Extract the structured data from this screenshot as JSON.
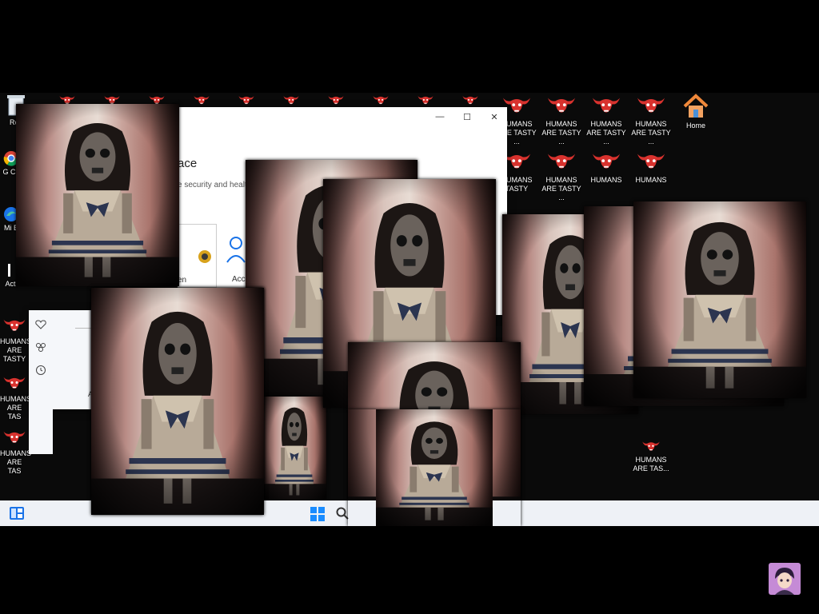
{
  "desktop": {
    "top_icons": [
      {
        "label": "Rec",
        "icon": "recycle-bin-icon"
      },
      {
        "label": "HUMANS ARE TASTY ...",
        "icon": "demon-skull-icon"
      },
      {
        "label": "HUMANS ARE TASTY ...",
        "icon": "demon-skull-icon"
      },
      {
        "label": "HUMANS ARE TASTY ...",
        "icon": "demon-skull-icon"
      },
      {
        "label": "HUMANS ARE TASTY ...",
        "icon": "demon-skull-icon"
      },
      {
        "label": "Home",
        "icon": "home-icon"
      }
    ],
    "second_row_icons": [
      {
        "label": "HUMANS TASTY"
      },
      {
        "label": "HUMANS ARE TASTY ..."
      },
      {
        "label": "HUMANS"
      },
      {
        "label": "HUMANS"
      }
    ],
    "left_icons": [
      {
        "label": "G Ch",
        "icon": "chrome-icon"
      },
      {
        "label": "Mi E",
        "icon": "edge-icon"
      },
      {
        "label": "Acti",
        "icon": "activity-icon"
      },
      {
        "label": "HUMANS ARE TASTY",
        "icon": "demon-skull-icon"
      },
      {
        "label": "HUMANS ARE TAS",
        "icon": "demon-skull-icon"
      },
      {
        "label": "HUMANS ARE TAS",
        "icon": "demon-skull-icon"
      }
    ],
    "bottom_icon": {
      "label": "HUMANS ARE TAS...",
      "icon": "demon-skull-icon"
    }
  },
  "window": {
    "title_fragment": "ace",
    "subtitle_fragment": "e security and healt",
    "tile_left_label": "en",
    "tile_right_label": "Acc",
    "controls": {
      "minimize": "—",
      "maximize": "☐",
      "close": "✕"
    }
  },
  "small_window": {
    "label": "A"
  },
  "taskbar": {
    "widgets_icon": "widgets-icon",
    "start_icon": "windows-start-icon",
    "search_icon": "search-icon"
  },
  "colors": {
    "demon_red": "#d8322e",
    "home_orange": "#f0883a",
    "accent_blue": "#1a73e8",
    "taskbar_bg": "#eef1f6"
  },
  "overlay": {
    "repeated_photo": "creepy-doll-photo",
    "avatar": "anime-avatar"
  }
}
